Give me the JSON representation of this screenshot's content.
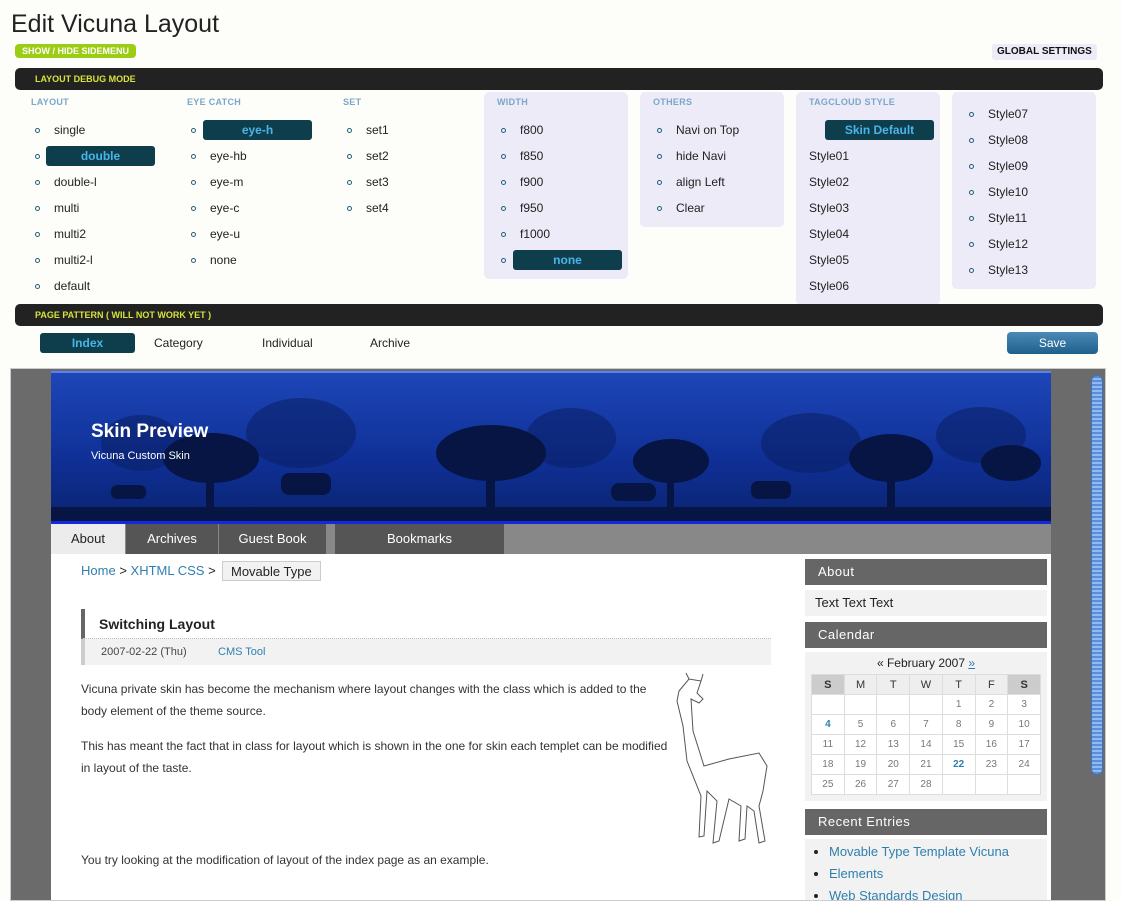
{
  "header": {
    "title": "Edit Vicuna Layout",
    "toggle_sidemenu": "SHOW / HIDE SIDEMENU",
    "global_settings": "GLOBAL SETTINGS"
  },
  "debug_bar": "LAYOUT DEBUG MODE",
  "columns": {
    "layout": {
      "title": "LAYOUT",
      "options": [
        "single",
        "double",
        "double-l",
        "multi",
        "multi2",
        "multi2-l",
        "default"
      ],
      "selected": "double"
    },
    "eyecatch": {
      "title": "EYE CATCH",
      "options": [
        "eye-h",
        "eye-hb",
        "eye-m",
        "eye-c",
        "eye-u",
        "none"
      ],
      "selected": "eye-h"
    },
    "set": {
      "title": "SET",
      "options": [
        "set1",
        "set2",
        "set3",
        "set4"
      ]
    },
    "width": {
      "title": "WIDTH",
      "options": [
        "f800",
        "f850",
        "f900",
        "f950",
        "f1000",
        "none"
      ],
      "selected": "none"
    },
    "others": {
      "title": "OTHERS",
      "options": [
        "Navi on Top",
        "hide Navi",
        "align Left",
        "Clear"
      ]
    },
    "tagcloud": {
      "title": "TAGCLOUD STYLE",
      "options": [
        "Skin Default",
        "Style01",
        "Style02",
        "Style03",
        "Style04",
        "Style05",
        "Style06"
      ],
      "selected": "Skin Default"
    },
    "tagcloud2": {
      "options": [
        "Style07",
        "Style08",
        "Style09",
        "Style10",
        "Style11",
        "Style12",
        "Style13"
      ]
    }
  },
  "page_pattern": {
    "title": "PAGE PATTERN ( WILL NOT WORK YET )",
    "tabs": [
      "Index",
      "Category",
      "Individual",
      "Archive"
    ],
    "selected": "Index",
    "save_label": "Save"
  },
  "preview": {
    "site_title": "Skin Preview",
    "site_subtitle": "Vicuna Custom Skin",
    "nav": [
      "About",
      "Archives",
      "Guest Book",
      "Bookmarks"
    ],
    "nav_selected": "About",
    "breadcrumb": {
      "home": "Home",
      "sep": ">",
      "cat": "XHTML CSS",
      "current": "Movable Type"
    },
    "entry": {
      "title": "Switching Layout",
      "date": "2007-02-22 (Thu)",
      "category": "CMS Tool",
      "p1": "Vicuna private skin has become the mechanism where layout changes with the class which is added to the body element of the theme source.",
      "p2": "This has meant the fact that in class for layout which is shown in the one for skin each templet can be modified in layout of the taste.",
      "p3": "You try looking at the modification of layout of the index page as an example."
    },
    "sidebar": {
      "about_title": "About",
      "about_text": "Text Text Text",
      "calendar_title": "Calendar",
      "calendar_month": "« February 2007",
      "calendar_next": "»",
      "weekdays": [
        "S",
        "M",
        "T",
        "W",
        "T",
        "F",
        "S"
      ],
      "weeks": [
        [
          "",
          "",
          "",
          "",
          "1",
          "2",
          "3"
        ],
        [
          "4",
          "5",
          "6",
          "7",
          "8",
          "9",
          "10"
        ],
        [
          "11",
          "12",
          "13",
          "14",
          "15",
          "16",
          "17"
        ],
        [
          "18",
          "19",
          "20",
          "21",
          "22",
          "23",
          "24"
        ],
        [
          "25",
          "26",
          "27",
          "28",
          "",
          "",
          ""
        ]
      ],
      "highlighted": [
        "4",
        "22"
      ],
      "recent_title": "Recent Entries",
      "recent": [
        "Movable Type Template Vicuna",
        "Elements",
        "Web Standards Design"
      ]
    }
  },
  "colors": {
    "accent_green": "#9acd13",
    "selected_bg": "#0e3e4c",
    "selected_text": "#4ab4e8",
    "banner_blue": "#1d46b8",
    "link": "#2e7fb0"
  },
  "icons": [
    "bullet-circle-icon",
    "vicuna-illustration"
  ]
}
